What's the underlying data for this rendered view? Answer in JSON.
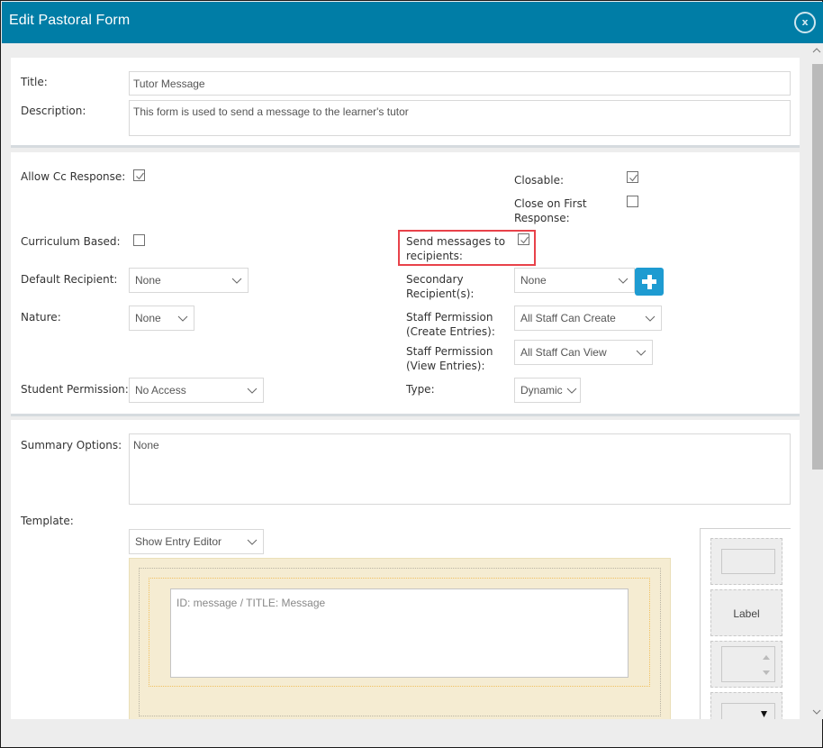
{
  "dialog": {
    "title": "Edit Pastoral Form",
    "close_icon_glyph": "x"
  },
  "basic": {
    "title_label": "Title:",
    "title_value": "Tutor Message",
    "description_label": "Description:",
    "description_value": "This form is used to send a message to the learner's tutor"
  },
  "settings": {
    "allow_cc_response": {
      "label": "Allow Cc Response:",
      "checked": true
    },
    "closable": {
      "label": "Closable:",
      "checked": true
    },
    "close_on_first_response": {
      "label_line1": "Close on First",
      "label_line2": "Response:",
      "checked": false
    },
    "curriculum_based": {
      "label": "Curriculum Based:",
      "checked": false
    },
    "send_messages": {
      "label_line1": "Send messages to",
      "label_line2": "recipients:",
      "checked": true,
      "highlight_color": "#e8424a"
    },
    "default_recipient": {
      "label": "Default Recipient:",
      "value": "None"
    },
    "secondary_recipients": {
      "label_line1": "Secondary",
      "label_line2": "Recipient(s):",
      "value": "None",
      "add_button_icon": "plus-icon"
    },
    "nature": {
      "label": "Nature:",
      "value": "None"
    },
    "staff_permission_create": {
      "label_line1": "Staff Permission",
      "label_line2": "(Create Entries):",
      "value": "All Staff Can Create"
    },
    "staff_permission_view": {
      "label_line1": "Staff Permission",
      "label_line2": "(View Entries):",
      "value": "All Staff Can View"
    },
    "student_permission": {
      "label": "Student Permission:",
      "value": "No Access"
    },
    "type": {
      "label": "Type:",
      "value": "Dynamic"
    }
  },
  "summary": {
    "summary_label": "Summary Options:",
    "summary_value": "None",
    "template_label": "Template:",
    "template_mode": "Show Entry Editor",
    "entry_field_text": "ID: message  /  TITLE: Message"
  },
  "toolbox": {
    "items": [
      {
        "name": "textbox-tool"
      },
      {
        "name": "label-tool",
        "label": "Label"
      },
      {
        "name": "number-spinner-tool"
      },
      {
        "name": "dropdown-tool"
      }
    ]
  },
  "colors": {
    "titlebar": "#007da6",
    "add_button": "#1e9bd1",
    "template_bg": "#f5ecd2"
  }
}
